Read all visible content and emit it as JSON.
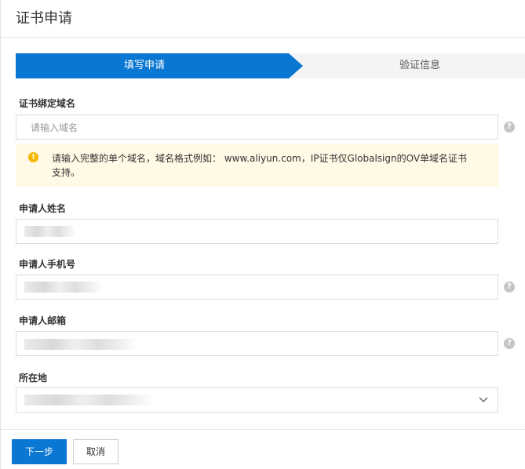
{
  "page": {
    "title": "证书申请"
  },
  "steps": [
    {
      "label": "填写申请",
      "active": true
    },
    {
      "label": "验证信息",
      "active": false
    }
  ],
  "form": {
    "domain": {
      "label": "证书绑定域名",
      "placeholder": "请输入域名",
      "help_icon": "?"
    },
    "notice": {
      "icon": "!",
      "text": "请输入完整的单个域名，域名格式例如： www.aliyun.com，IP证书仅Globalsign的OV单域名证书支持。"
    },
    "name": {
      "label": "申请人姓名"
    },
    "phone": {
      "label": "申请人手机号",
      "help_icon": "?"
    },
    "email": {
      "label": "申请人邮箱",
      "help_icon": "?"
    },
    "location": {
      "label": "所在地"
    }
  },
  "buttons": {
    "next": "下一步",
    "cancel": "取消"
  },
  "colors": {
    "primary": "#0a77d3",
    "notice_bg": "#fff9e5",
    "notice_icon": "#f6b700"
  }
}
